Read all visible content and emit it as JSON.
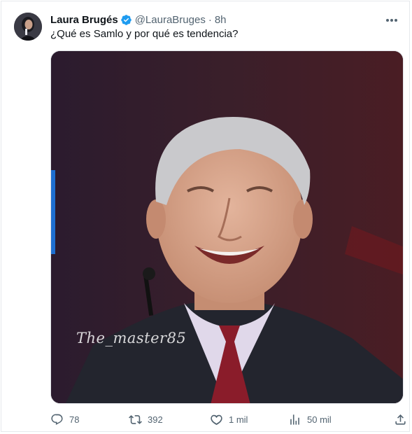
{
  "author": {
    "name": "Laura Brugés",
    "handle": "@LauraBruges",
    "separator": "·",
    "time": "8h",
    "verified": true
  },
  "tweet": {
    "text": "¿Qué es Samlo y por qué es tendencia?",
    "image_watermark": "The_master85"
  },
  "actions": {
    "replies": "78",
    "retweets": "392",
    "likes": "1 mil",
    "views": "50 mil"
  },
  "icons": {
    "verified": "verified-badge-icon",
    "more": "more-options-icon",
    "reply": "reply-icon",
    "retweet": "retweet-icon",
    "like": "heart-icon",
    "views": "views-chart-icon",
    "share": "share-icon"
  },
  "colors": {
    "accent": "#1d9bf0",
    "muted": "#536471",
    "text": "#0f1419"
  }
}
